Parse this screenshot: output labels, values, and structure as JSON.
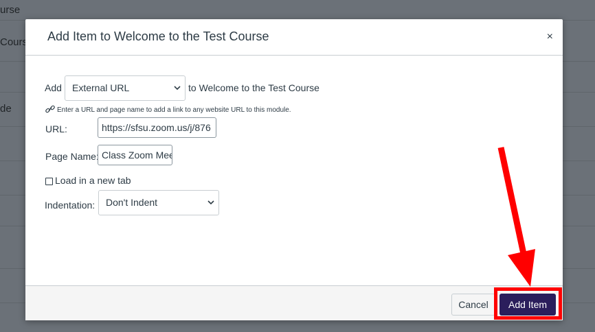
{
  "background": {
    "rows": [
      "urse",
      "Cours",
      "",
      "de"
    ]
  },
  "modal": {
    "title": "Add Item to Welcome to the Test Course",
    "close_symbol": "×",
    "add_label": "Add",
    "item_type": "External URL",
    "to_module_text": "to Welcome to the Test Course",
    "hint": "Enter a URL and page name to add a link to any website URL to this module.",
    "url_label": "URL:",
    "url_value": "https://sfsu.zoom.us/j/876",
    "page_name_label": "Page Name:",
    "page_name_value": "Class Zoom Mee",
    "new_tab_label": "Load in a new tab",
    "new_tab_checked": false,
    "indentation_label": "Indentation:",
    "indentation_value": "Don't Indent",
    "cancel_label": "Cancel",
    "add_item_label": "Add Item"
  },
  "annotation": {
    "color": "#ff0000"
  },
  "colors": {
    "primary_button": "#2b1e5c",
    "text": "#2d3b45"
  }
}
